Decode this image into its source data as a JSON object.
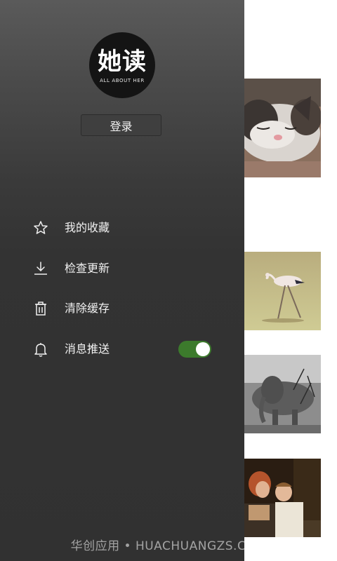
{
  "drawer": {
    "logo": {
      "main_text": "她读",
      "sub_text": "ALL ABOUT HER"
    },
    "login_label": "登录",
    "menu": [
      {
        "label": "我的收藏",
        "icon": "star-icon"
      },
      {
        "label": "检查更新",
        "icon": "download-icon"
      },
      {
        "label": "清除缓存",
        "icon": "trash-icon"
      },
      {
        "label": "消息推送",
        "icon": "bell-icon",
        "toggle_on": true
      }
    ]
  },
  "background": {
    "thumbnails": [
      "cat-photo",
      "flamingo-photo",
      "elephant-photo",
      "couple-photo"
    ]
  },
  "watermark": "华创应用 • HUACHUANGZS.COM",
  "colors": {
    "drawer_top": "#5a5a5a",
    "drawer_bottom": "#313131",
    "toggle_on": "#3c7a2c",
    "logo_bg": "#141414"
  }
}
